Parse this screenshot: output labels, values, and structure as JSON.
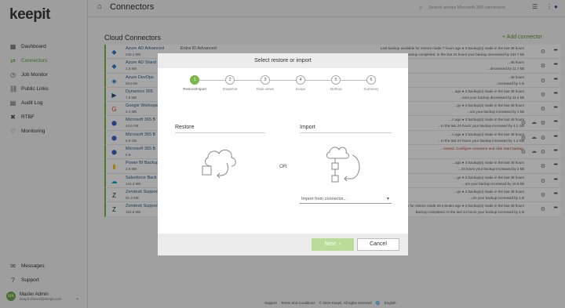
{
  "app": {
    "logo_text": "keepit"
  },
  "sidebar": {
    "items": [
      {
        "label": "Dashboard",
        "icon": "dashboard-icon",
        "glyph": "▦"
      },
      {
        "label": "Connectors",
        "icon": "connectors-icon",
        "glyph": "⇄",
        "active": true
      },
      {
        "label": "Job Monitor",
        "icon": "job-monitor-icon",
        "glyph": "◷"
      },
      {
        "label": "Public Links",
        "icon": "public-links-icon",
        "glyph": "⛓"
      },
      {
        "label": "Audit Log",
        "icon": "audit-log-icon",
        "glyph": "▤"
      },
      {
        "label": "RTBF",
        "icon": "rtbf-icon",
        "glyph": "✖"
      },
      {
        "label": "Monitoring",
        "icon": "monitoring-icon",
        "glyph": "♡"
      }
    ],
    "bottom": [
      {
        "label": "Messages",
        "icon": "messages-icon",
        "glyph": "✉"
      },
      {
        "label": "Support",
        "icon": "support-icon",
        "glyph": "?"
      }
    ],
    "user": {
      "initials": "MA",
      "name": "Master Admin",
      "email": "keepit.shared@keepit.com"
    }
  },
  "topbar": {
    "title": "Connectors",
    "search_placeholder": "Search across Microsoft 365 connectors"
  },
  "main": {
    "section_title": "Cloud Connectors",
    "add_label": "+ Add connector",
    "rows": [
      {
        "name": "Azure AD Advanced",
        "extra": "Entra ID Advanced",
        "size": "240.1 MB",
        "s1": "Last backup available for restore made 7 hours ago ● 3 backup(s) made in the last 48 hours",
        "s2": "Backup completed. In the last 24 hours your backup decreased by 104.7 kB",
        "icon": "azure-ad-icon",
        "glyph": "◆",
        "color": "#2b7cd3"
      },
      {
        "name": "Azure AD Stand",
        "size": "1.5 MB",
        "s1": "…48 hours",
        "s2": "…decreased by 11.7 kB",
        "icon": "azure-ad-icon",
        "glyph": "◆",
        "color": "#2b7cd3"
      },
      {
        "name": "Azure DevOps",
        "size": "69.9 kB",
        "s1": "…48 hours",
        "s2": "…increased by 1 B",
        "icon": "azure-devops-icon",
        "glyph": "◈",
        "color": "#0078d4"
      },
      {
        "name": "Dynamics 365",
        "size": "7.5 MB",
        "s1": "…ago ● 3 backup(s) made in the last 48 hours",
        "s2": "…ours your backup decreased by 11.4 kB",
        "icon": "dynamics-icon",
        "glyph": "▶",
        "color": "#1a4f8b"
      },
      {
        "name": "Google Workspace",
        "size": "3.4 MB",
        "s1": "…go ● 3 backup(s) made in the last 48 hours",
        "s2": "…urs your backup increased by 1 kB",
        "icon": "google-icon",
        "glyph": "G",
        "color": "#ea4335"
      },
      {
        "name": "Microsoft 365 B",
        "size": "43.6 GB",
        "s1": "…n ago ● 3 backup(s) made in the last 48 hours",
        "s2": "…In the last 24 hours your backup increased by 4.1 GB",
        "icon": "m365-icon",
        "glyph": "⬢",
        "color": "#3563c9",
        "cloud": true
      },
      {
        "name": "Microsoft 365 B",
        "size": "5.8 GB",
        "s1": "…n ago ● 3 backup(s) made in the last 48 hours",
        "s2": "…In the last 24 hours your backup increased by 1.4 GB",
        "icon": "m365-icon",
        "glyph": "⬢",
        "color": "#3563c9",
        "cloud": true
      },
      {
        "name": "Microsoft 365 B",
        "size": "0 B",
        "s1": "…nected. Configure connector and click Start backup.",
        "s2": "",
        "icon": "m365-icon",
        "glyph": "⬢",
        "color": "#3563c9",
        "error": true,
        "cloud": true
      },
      {
        "name": "Power BI Backup",
        "size": "2.9 MB",
        "s1": "…ago ● 3 backup(s) made in the last 48 hours",
        "s2": "…24 hours your backup increased by 2 kB",
        "icon": "power-bi-icon",
        "glyph": "▮",
        "color": "#f2c811"
      },
      {
        "name": "Salesforce Back",
        "size": "144.4 MB",
        "s1": "…go ● 3 backup(s) made in the last 48 hours",
        "s2": "…urs your backup increased by 10.8 kB",
        "icon": "salesforce-icon",
        "glyph": "☁",
        "color": "#00a1e0"
      },
      {
        "name": "Zendesk Support",
        "size": "91.3 MB",
        "s1": "…go ● 3 backup(s) made in the last 48 hours",
        "s2": "…urs your backup increased by 1 B",
        "icon": "zendesk-icon",
        "glyph": "Z",
        "color": "#03363d"
      },
      {
        "name": "Zendesk Support Keepit DEMO Backup",
        "size": "194.6 MB",
        "s1": "Last backup available for restore made 29 minutes ago ● 3 backup(s) made in the last 48 hours",
        "s2": "Backup completed. In the last 24 hours your backup increased by 1 B",
        "icon": "zendesk-icon",
        "glyph": "Z",
        "color": "#03363d"
      }
    ]
  },
  "footer": {
    "support": "Support",
    "terms": "Terms and Conditions",
    "copyright": "© 2024 Keepit. All rights reserved",
    "lang": "English"
  },
  "modal": {
    "title": "Select restore or import",
    "steps": [
      {
        "num": "1",
        "label": "Restore/Import",
        "active": true
      },
      {
        "num": "2",
        "label": "Snapshot"
      },
      {
        "num": "3",
        "label": "Data views"
      },
      {
        "num": "4",
        "label": "Scope"
      },
      {
        "num": "5",
        "label": "Method"
      },
      {
        "num": "6",
        "label": "Summary"
      }
    ],
    "restore_title": "Restore",
    "import_title": "Import",
    "or_label": "OR",
    "import_picker": "Import from connector...",
    "next_label": "Next",
    "cancel_label": "Cancel",
    "accent": "#7ab648"
  }
}
